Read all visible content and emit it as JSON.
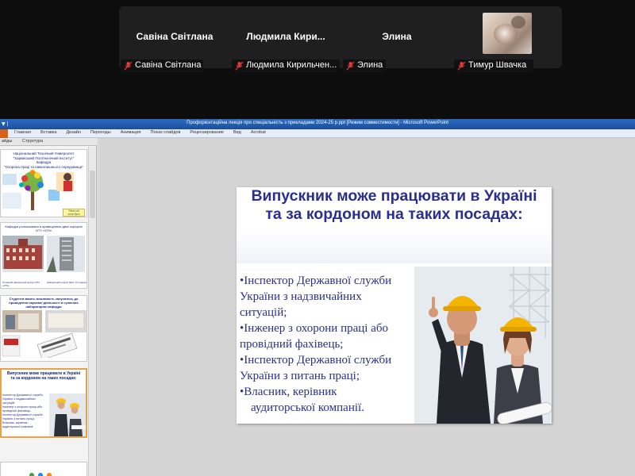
{
  "meeting": {
    "participants": [
      {
        "display_name": "Савіна Світлана",
        "name_label": "Савіна Світлана",
        "muted": true
      },
      {
        "display_name": "Людмила  Кири...",
        "name_label": "Людмила Кирильчен...",
        "muted": true
      },
      {
        "display_name": "Элина",
        "name_label": "Элина",
        "muted": true
      },
      {
        "display_name": "",
        "name_label": "Тимур Швачка",
        "muted": true,
        "has_video": true
      }
    ]
  },
  "ppt": {
    "window_title": "Профорієнтаційна лекція про  спеціальність з прикладами 2024-25 р.ppt [Режим совместимости] - Microsoft PowerPoint",
    "quick_access": "▼ |",
    "ribbon_tabs": [
      "Главная",
      "Вставка",
      "Дизайн",
      "Переходы",
      "Анимация",
      "Показ слайдов",
      "Рецензирование",
      "Вид",
      "Acrobat"
    ],
    "pane_tabs": [
      "айды",
      "Структура"
    ],
    "thumbs": {
      "t1": {
        "lines": [
          "Національний Технічний Університет",
          "\"Харківський Політехнічний Інститут\"",
          "Кафедра",
          "\"Охорона праці та навколишнього середовища\""
        ],
        "tag": "\"Ніхто не",
        "tag2": "хоче бути"
      },
      "t2": {
        "title": "Кафедра розташована в приміщеннях двох корпусів НТУ «ХПІ»",
        "cap1": "Головний навчальний корпус НТУ «ХПІ»",
        "cap2": "Навчальний корпус №10, 10 поверх"
      },
      "t3": {
        "title": "Студенти мають можливість залучатись до проведення наукової діяльності в сучасних лабораторіях кафедри"
      },
      "t4": {
        "title": "Випускник може працювати в Україні та за кордоном на таких посадах:",
        "lines": [
          "Інспектор Державної служби",
          "України з надзвичайних",
          "ситуацій;",
          "Інженер з охорони праці або",
          "провідний фахівець;",
          "Інспектор Державної служби",
          "України з питань праці;",
          "Власник, керівник",
          "аудиторської компанії."
        ]
      }
    },
    "slide": {
      "title": "Випускник може працювати в Україні та за кордоном на таких посадах:",
      "bullets": [
        "•Інспектор Державної служби",
        "України з надзвичайних",
        "ситуацій;",
        "•Інженер з охорони праці або",
        "провідний фахівець;",
        "•Інспектор Державної служби",
        "України з питань праці;",
        "•Власник, керівник",
        "аудиторської компанії."
      ]
    }
  }
}
